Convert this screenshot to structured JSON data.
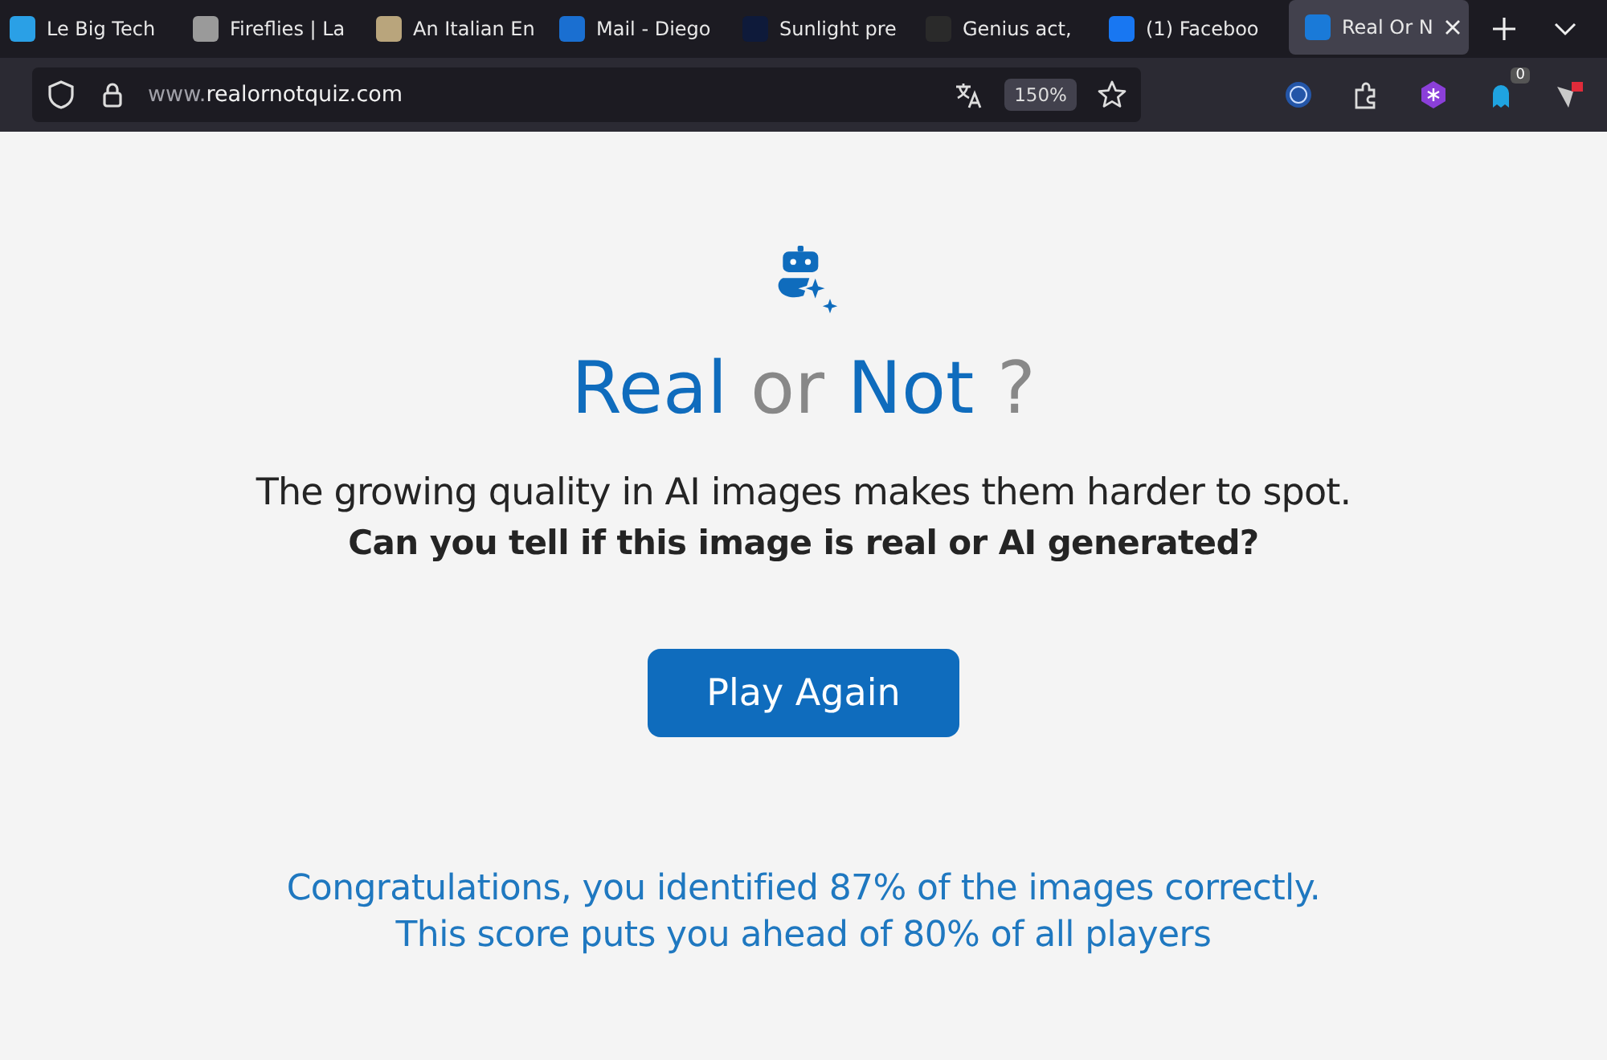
{
  "tabs": [
    {
      "label": "Le Big Tech",
      "selected": false,
      "color": "#2aa0e6"
    },
    {
      "label": "Fireflies | La",
      "selected": false,
      "color": "#9a9a9a"
    },
    {
      "label": "An Italian En",
      "selected": false,
      "color": "#b9a57c"
    },
    {
      "label": "Mail - Diego",
      "selected": false,
      "color": "#1a6fd1"
    },
    {
      "label": "Sunlight pre",
      "selected": false,
      "color": "#0e1a3a"
    },
    {
      "label": "Genius act,",
      "selected": false,
      "color": "#2a2a2a"
    },
    {
      "label": "(1) Faceboo",
      "selected": false,
      "color": "#1877f2"
    },
    {
      "label": "Real Or N",
      "selected": true,
      "color": "#1a7ad8"
    }
  ],
  "address_bar": {
    "url_prefix": "www.",
    "url_domain": "realornotquiz.com",
    "zoom": "150%"
  },
  "toolbar": {
    "badge": "0"
  },
  "title_parts": [
    {
      "text": "Real",
      "kind": "accent"
    },
    {
      "text": "or",
      "kind": "muted"
    },
    {
      "text": "Not",
      "kind": "accent"
    },
    {
      "text": "?",
      "kind": "muted"
    }
  ],
  "intro": "The growing quality in AI images makes them harder to spot.",
  "question": "Can you tell if this image is real or AI generated?",
  "button": "Play Again",
  "result_lines": [
    "Congratulations, you identified 87% of the images correctly.",
    "This score puts you ahead of 80% of all players"
  ]
}
